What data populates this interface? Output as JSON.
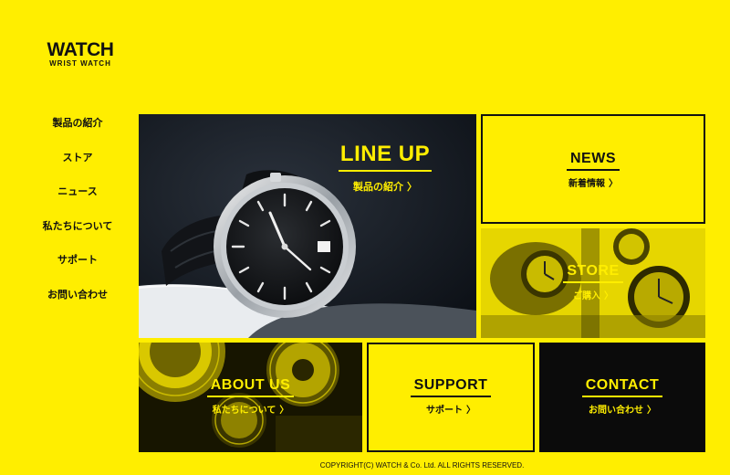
{
  "logo": {
    "main": "WATCH",
    "sub": "WRIST WATCH"
  },
  "nav": {
    "items": [
      {
        "label": "製品の紹介"
      },
      {
        "label": "ストア"
      },
      {
        "label": "ニュース"
      },
      {
        "label": "私たちについて"
      },
      {
        "label": "サポート"
      },
      {
        "label": "お問い合わせ"
      }
    ]
  },
  "panels": {
    "lineup": {
      "title": "LINE UP",
      "sub": "製品の紹介"
    },
    "news": {
      "title": "NEWS",
      "sub": "新着情報"
    },
    "store": {
      "title": "STORE",
      "sub": "ご購入"
    },
    "about": {
      "title": "ABOUT US",
      "sub": "私たちについて"
    },
    "support": {
      "title": "SUPPORT",
      "sub": "サポート"
    },
    "contact": {
      "title": "CONTACT",
      "sub": "お問い合わせ"
    }
  },
  "arrow": "〉",
  "footer": {
    "copyright": "COPYRIGHT(C) WATCH & Co. Ltd. ALL RIGHTS RESERVED."
  },
  "colors": {
    "accent": "#FFEE00",
    "dark": "#0b0b0b"
  }
}
